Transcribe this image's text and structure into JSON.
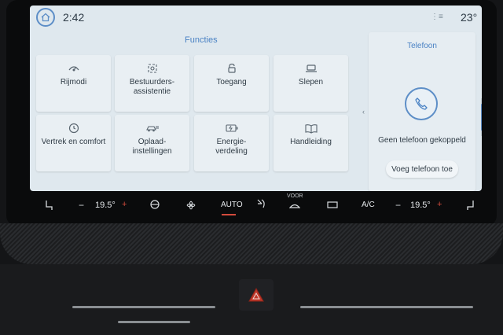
{
  "status": {
    "time": "2:42",
    "outside_temp": "23°",
    "signal_icon": "signal-icon"
  },
  "functions": {
    "title": "Functies",
    "tiles": [
      {
        "label": "Rijmodi",
        "icon": "drive-mode-icon"
      },
      {
        "label": "Bestuurders-\nassistentie",
        "icon": "driver-assist-icon"
      },
      {
        "label": "Toegang",
        "icon": "lock-icon"
      },
      {
        "label": "Slepen",
        "icon": "tow-icon"
      },
      {
        "label": "Vertrek en comfort",
        "icon": "clock-icon"
      },
      {
        "label": "Oplaad-\ninstellingen",
        "icon": "charging-icon"
      },
      {
        "label": "Energie-\nverdeling",
        "icon": "energy-icon"
      },
      {
        "label": "Handleiding",
        "icon": "manual-icon"
      }
    ]
  },
  "phone": {
    "title": "Telefoon",
    "status": "Geen telefoon gekoppeld",
    "add_button": "Voeg telefoon toe"
  },
  "climate": {
    "left_temp": "19.5°",
    "right_temp": "19.5°",
    "auto_label": "AUTO",
    "ac_label": "A/C",
    "front_label": "VOOR"
  },
  "colors": {
    "accent": "#4a82c4",
    "screen_bg": "#dfe8ee",
    "tile_bg": "#e9eff3",
    "heat_red": "#d24b3c"
  }
}
